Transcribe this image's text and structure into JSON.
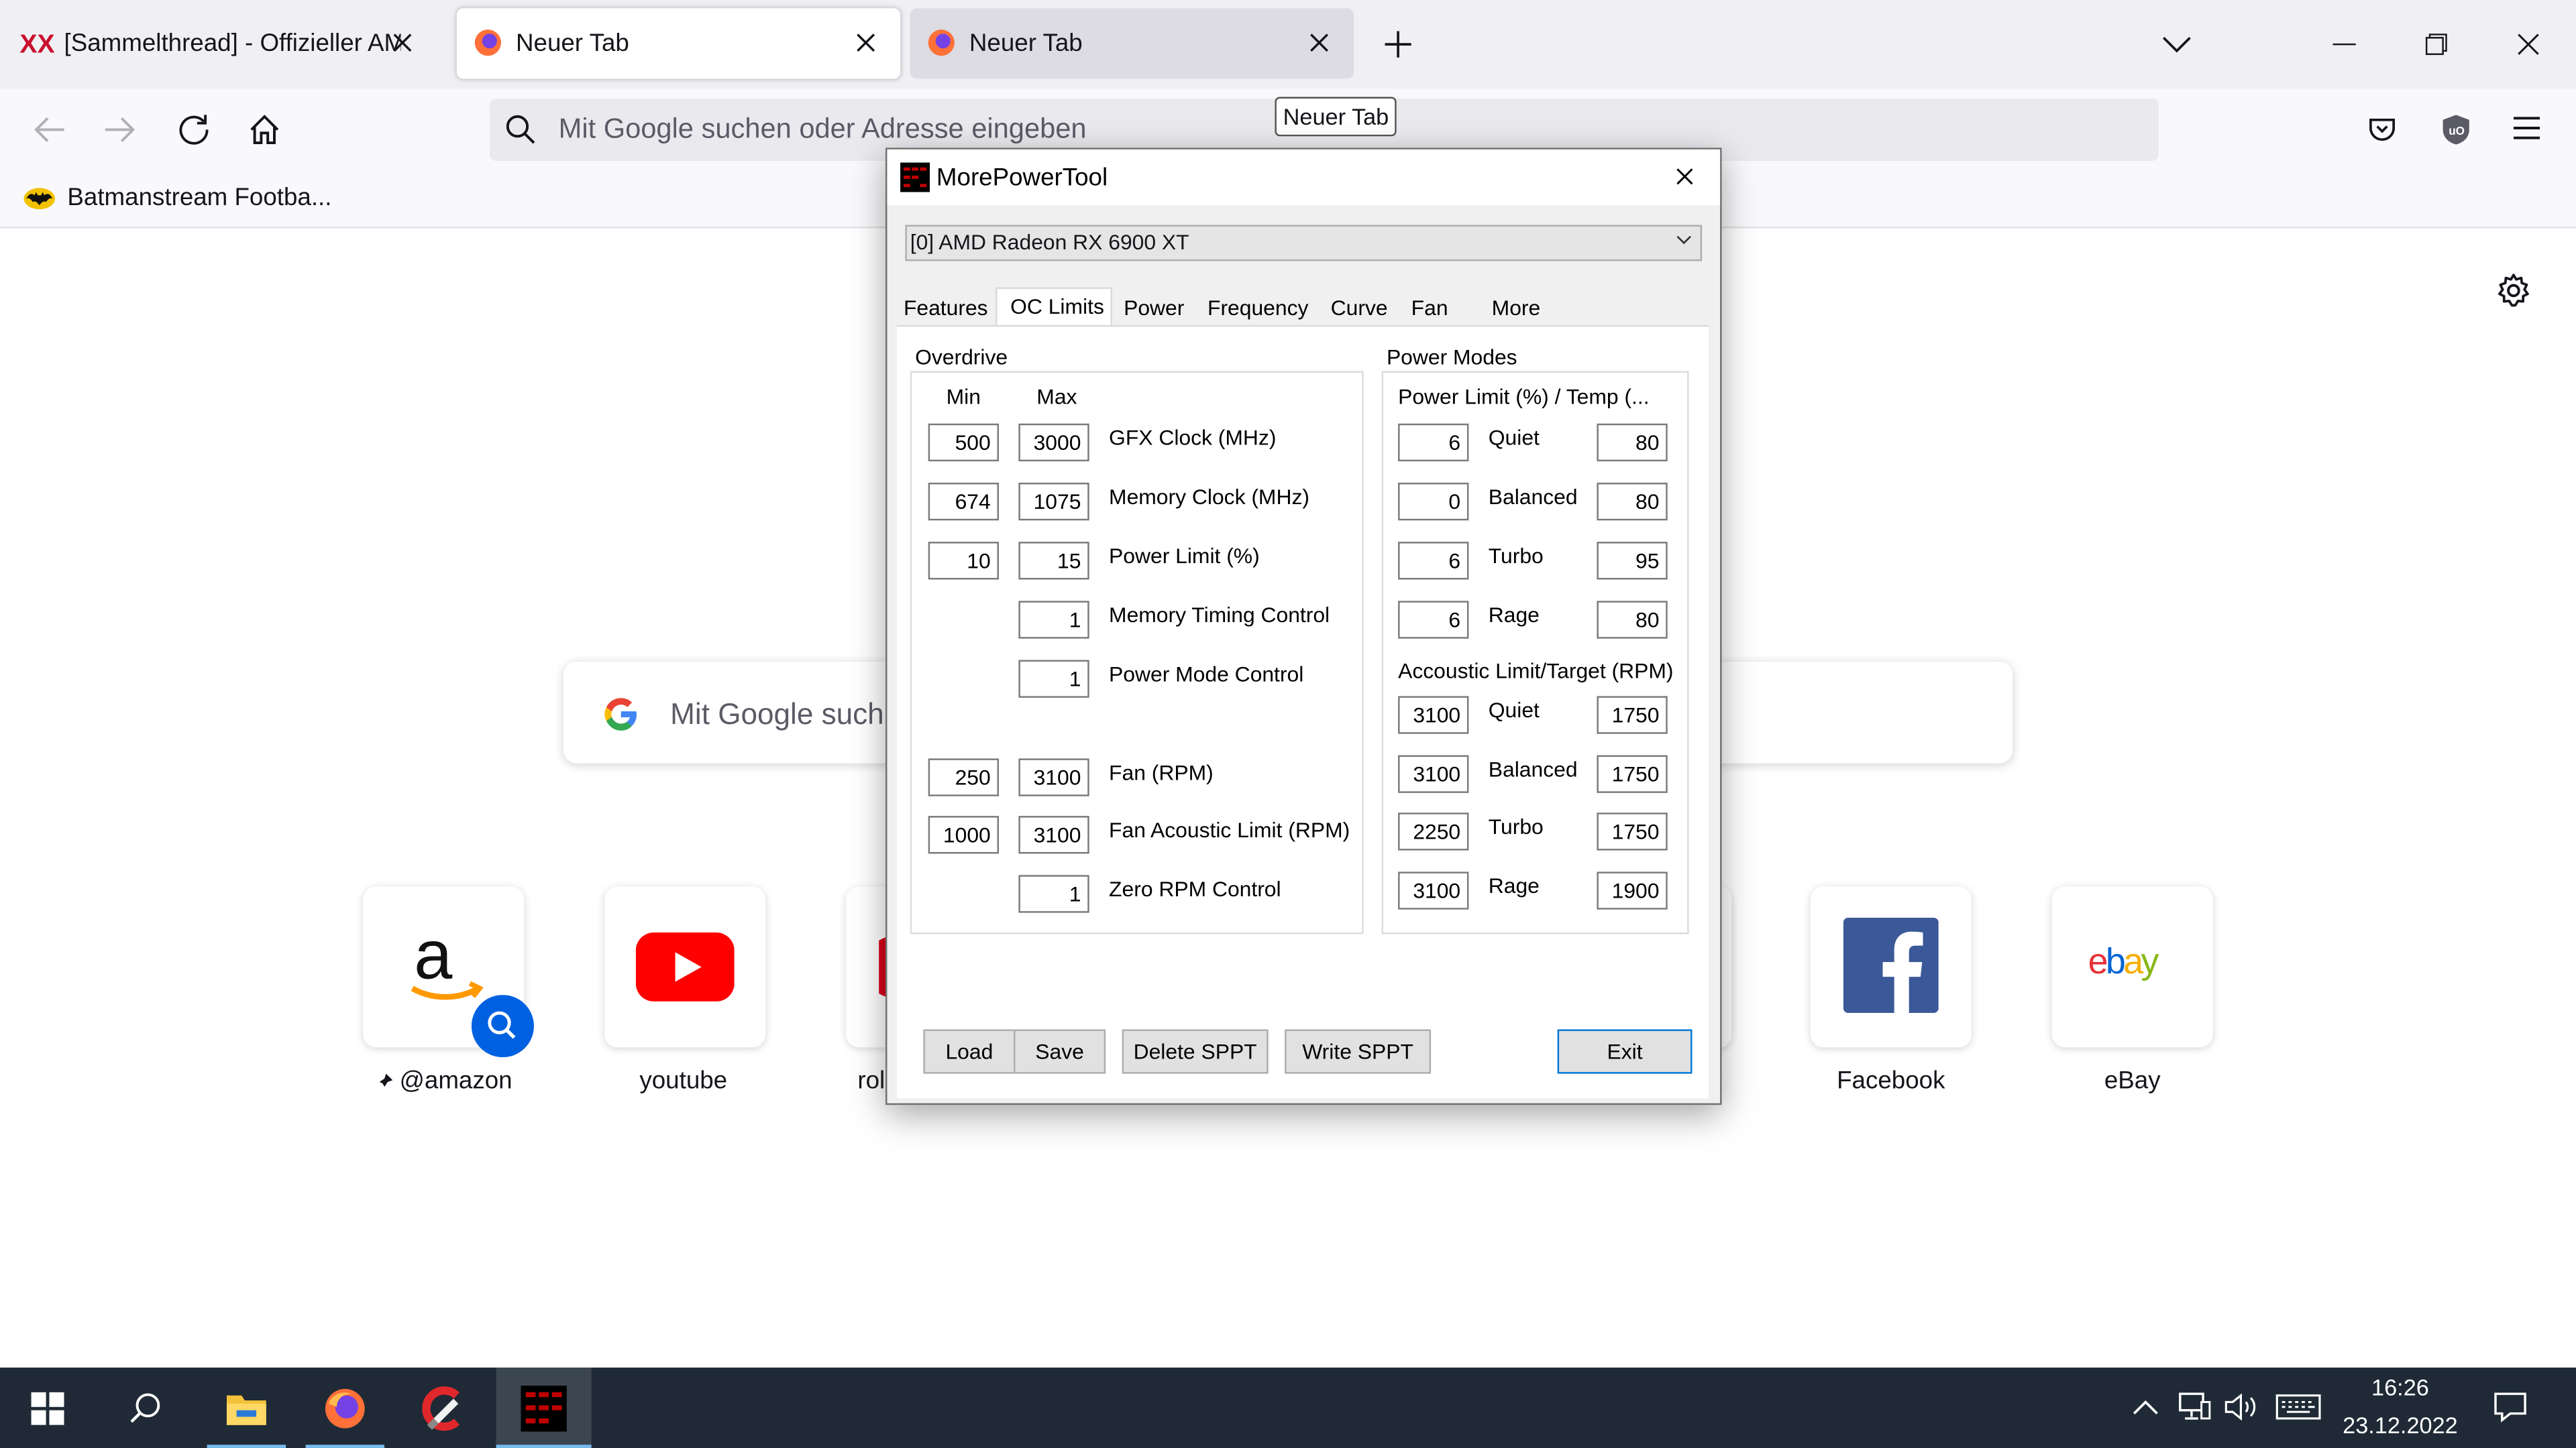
{
  "browser": {
    "tabs": [
      {
        "title": "[Sammelthread] - Offizieller AM",
        "state": "inactive"
      },
      {
        "title": "Neuer Tab",
        "state": "active"
      },
      {
        "title": "Neuer Tab",
        "state": "inactive"
      }
    ],
    "tooltip": "Neuer Tab",
    "url_placeholder": "Mit Google suchen oder Adresse eingeben",
    "bookmark": "Batmanstream Footba..."
  },
  "newtab": {
    "search_placeholder": "Mit Google such",
    "shortcuts": [
      {
        "label": "@amazon"
      },
      {
        "label": "youtube"
      },
      {
        "label": "rol"
      },
      {
        "label": "Facebook"
      },
      {
        "label": "eBay"
      }
    ]
  },
  "taskbar": {
    "time": "16:26",
    "date": "23.12.2022",
    "accent": "#76b9ed"
  },
  "dialog": {
    "title": "MorePowerTool",
    "device": "[0] AMD Radeon RX 6900 XT",
    "tabs": [
      "Features",
      "OC Limits",
      "Power",
      "Frequency",
      "Curve",
      "Fan",
      "More"
    ],
    "active_tab": "OC Limits",
    "overdrive": {
      "label": "Overdrive",
      "min_header": "Min",
      "max_header": "Max",
      "rows": [
        {
          "label": "GFX Clock (MHz)",
          "min": "500",
          "max": "3000"
        },
        {
          "label": "Memory Clock (MHz)",
          "min": "674",
          "max": "1075"
        },
        {
          "label": "Power Limit (%)",
          "min": "10",
          "max": "15"
        },
        {
          "label": "Memory Timing Control",
          "min": "",
          "max": "1"
        },
        {
          "label": "Power Mode Control",
          "min": "",
          "max": "1"
        },
        {
          "label": "Fan (RPM)",
          "min": "250",
          "max": "3100"
        },
        {
          "label": "Fan Acoustic Limit (RPM)",
          "min": "1000",
          "max": "3100"
        },
        {
          "label": "Zero RPM Control",
          "min": "",
          "max": "1"
        }
      ]
    },
    "power_modes": {
      "label": "Power Modes",
      "power_header": "Power Limit (%) / Temp (...",
      "power_rows": [
        {
          "label": "Quiet",
          "limit": "6",
          "temp": "80"
        },
        {
          "label": "Balanced",
          "limit": "0",
          "temp": "80"
        },
        {
          "label": "Turbo",
          "limit": "6",
          "temp": "95"
        },
        {
          "label": "Rage",
          "limit": "6",
          "temp": "80"
        }
      ],
      "acoustic_header": "Accoustic Limit/Target (RPM)",
      "acoustic_rows": [
        {
          "label": "Quiet",
          "limit": "3100",
          "target": "1750"
        },
        {
          "label": "Balanced",
          "limit": "3100",
          "target": "1750"
        },
        {
          "label": "Turbo",
          "limit": "2250",
          "target": "1750"
        },
        {
          "label": "Rage",
          "limit": "3100",
          "target": "1900"
        }
      ]
    },
    "buttons": {
      "load": "Load",
      "save": "Save",
      "delete_sppt": "Delete SPPT",
      "write_sppt": "Write SPPT",
      "exit": "Exit"
    }
  }
}
